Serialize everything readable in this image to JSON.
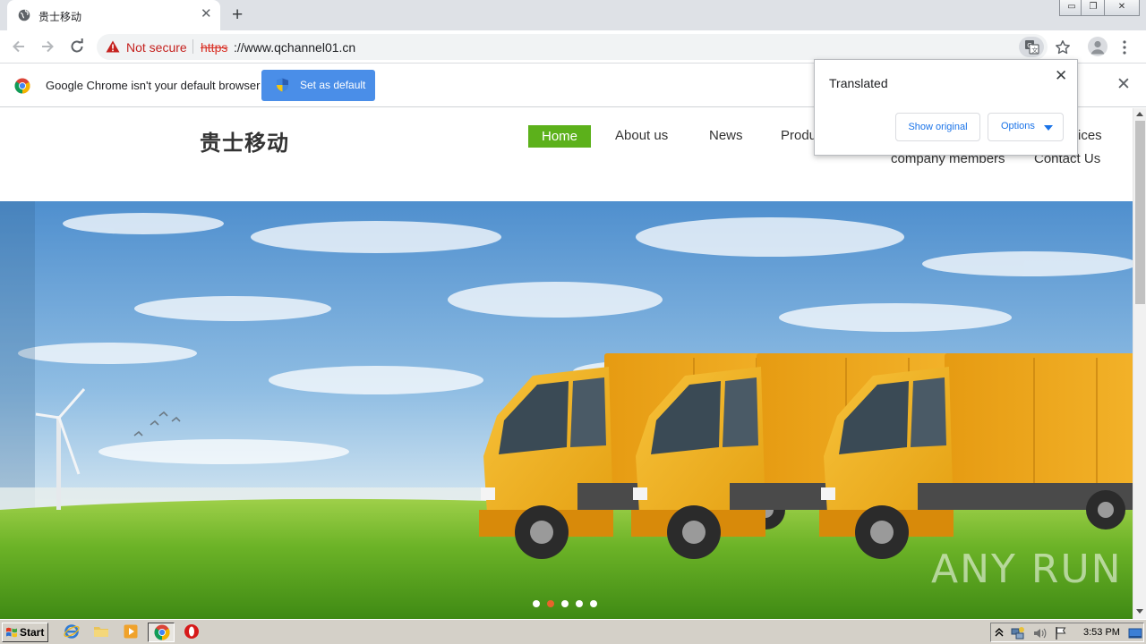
{
  "browser": {
    "tab": {
      "title": "贵士移动",
      "close_glyph": "✕"
    },
    "new_tab_glyph": "+",
    "window_controls": {
      "minimize_glyph": "▭",
      "restore_glyph": "❐",
      "close_glyph": "✕"
    },
    "security_label": "Not secure",
    "url_scheme": "https",
    "url_rest": "://www.qchannel01.cn",
    "icons": [
      "back-arrow-icon",
      "forward-arrow-icon",
      "reload-icon",
      "warning-triangle-icon",
      "translate-icon",
      "star-icon",
      "profile-avatar-icon",
      "more-vertical-icon"
    ]
  },
  "infobar": {
    "message": "Google Chrome isn't your default browser",
    "button_label": "Set as default",
    "close_glyph": "✕"
  },
  "translate_bubble": {
    "title": "Translated",
    "show_original_label": "Show original",
    "options_label": "Options",
    "close_glyph": "✕"
  },
  "site": {
    "logo_text": "贵士移动",
    "nav": {
      "home": "Home",
      "about": "About us",
      "news": "News",
      "products_partial": "Produ",
      "services_partial": "ices",
      "members": "company members",
      "contact": "Contact Us"
    },
    "carousel": {
      "slide_count": 5,
      "active_index": 1,
      "active_color": "#e8632b"
    },
    "accent_color": "#5cb11b"
  },
  "watermark": "ANY RUN",
  "taskbar": {
    "start_label": "Start",
    "clock": "3:53 PM",
    "icons": [
      "internet-explorer-icon",
      "folder-icon",
      "media-player-icon",
      "chrome-icon",
      "opera-icon"
    ]
  }
}
